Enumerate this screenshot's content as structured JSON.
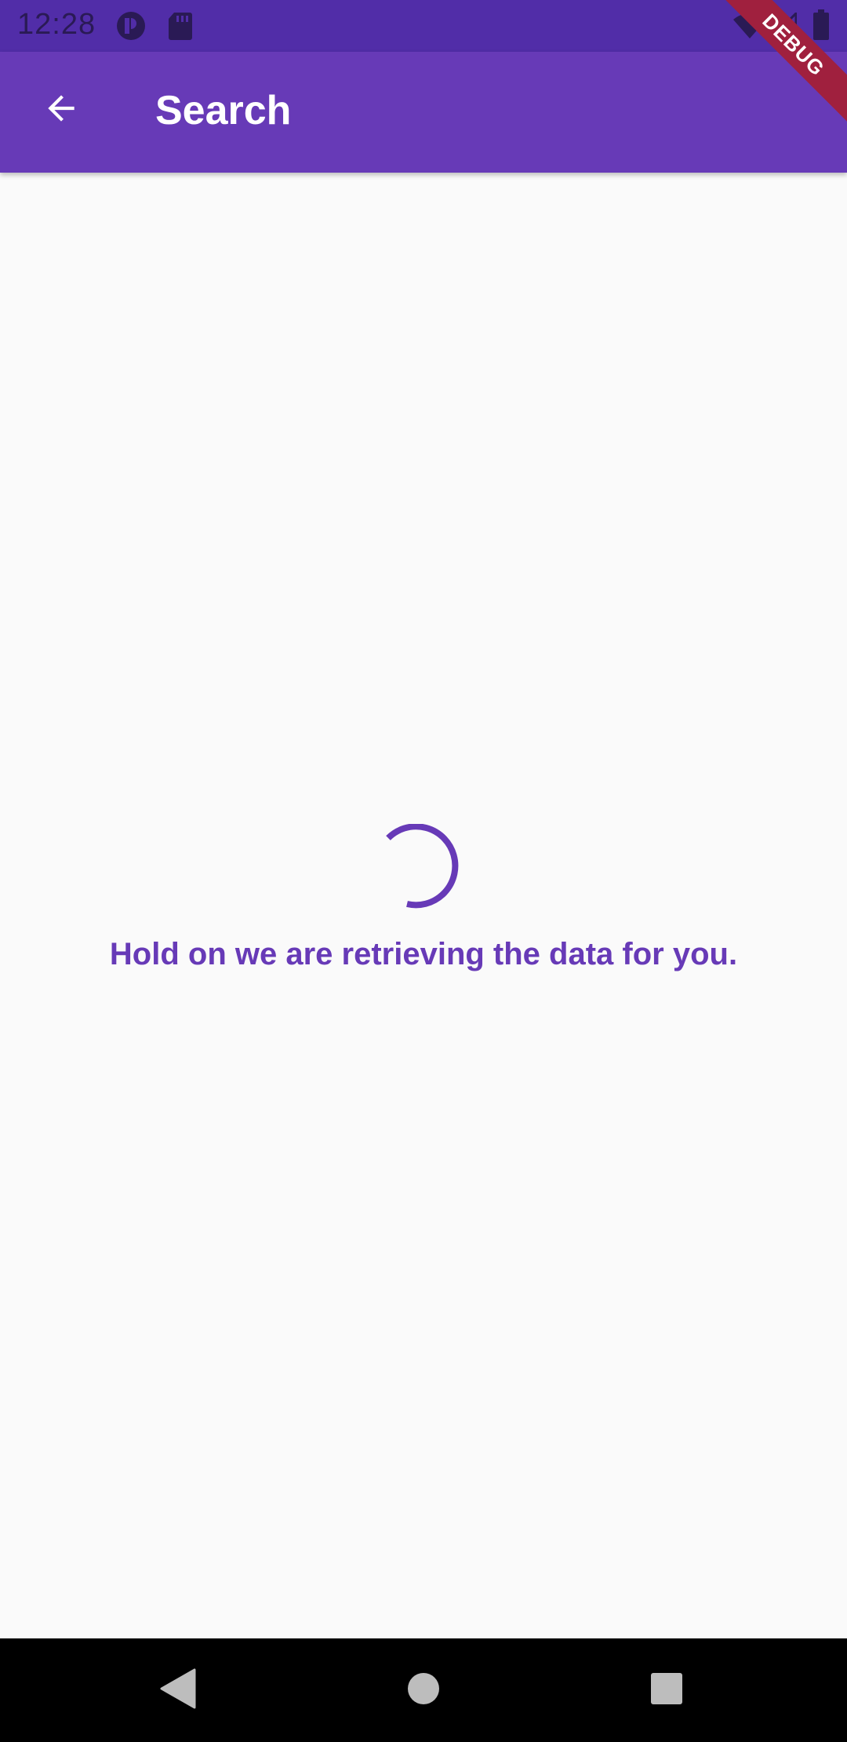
{
  "status_bar": {
    "time": "12:28",
    "icons": [
      "app-notification-icon",
      "sd-card-icon",
      "wifi-icon",
      "signal-icon",
      "battery-icon"
    ]
  },
  "app_bar": {
    "title": "Search",
    "back_icon": "arrow-back-icon"
  },
  "debug_banner": {
    "label": "DEBUG"
  },
  "content": {
    "loading_message": "Hold on we are retrieving the data for you."
  },
  "nav_bar": {
    "icons": [
      "nav-back-icon",
      "nav-home-icon",
      "nav-recents-icon"
    ]
  },
  "colors": {
    "primary": "#673ab7",
    "primary_dark": "#512da8",
    "background": "#fafafa",
    "debug_banner": "#a0203e"
  }
}
